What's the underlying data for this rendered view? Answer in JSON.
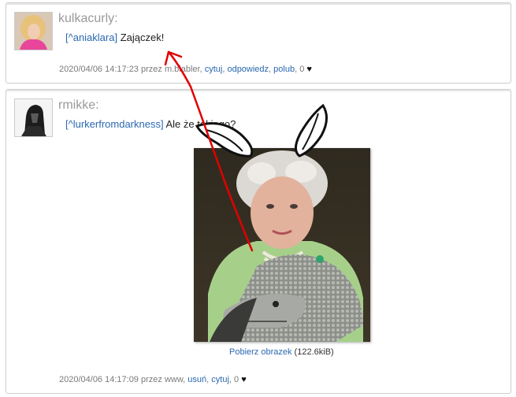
{
  "posts": [
    {
      "username": "kulkacurly:",
      "mention": "[^aniaklara]",
      "message": " Zajączek!",
      "timestamp": "2020/04/06 14:17:23 przez m.blabler,",
      "actions": [
        "cytuj",
        "odpowiedz",
        "polub"
      ],
      "likes": "0"
    },
    {
      "username": "rmikke:",
      "mention": "[^lurkerfromdarkness]",
      "message": " Ale że takiego?",
      "timestamp": "2020/04/06 14:17:09 przez www,",
      "actions": [
        "usuń",
        "cytuj"
      ],
      "likes": "0",
      "download_label": "Pobierz obrazek",
      "download_size": " (122.6kiB)"
    }
  ],
  "colors": {
    "link": "#2a68b0",
    "annotation": "#e00000",
    "muted": "#9a9a9a"
  }
}
